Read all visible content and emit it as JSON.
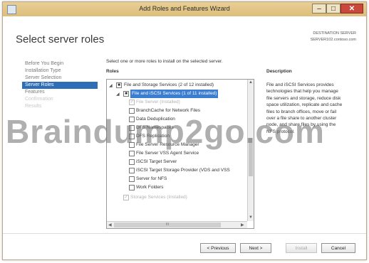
{
  "window": {
    "title": "Add Roles and Features Wizard",
    "controls": {
      "minimize": "‒",
      "maximize": "□",
      "close": "✕"
    }
  },
  "header": {
    "page_title": "Select server roles",
    "destination_label": "DESTINATION SERVER",
    "destination_server": "SERVER102.contoso.com"
  },
  "nav": {
    "items": [
      {
        "label": "Before You Begin"
      },
      {
        "label": "Installation Type"
      },
      {
        "label": "Server Selection"
      },
      {
        "label": "Server Roles"
      },
      {
        "label": "Features"
      },
      {
        "label": "Confirmation"
      },
      {
        "label": "Results"
      }
    ]
  },
  "main": {
    "instruction": "Select one or more roles to install on the selected server.",
    "roles_header": "Roles",
    "roles": [
      "File and Storage Services (2 of 12 installed)",
      "File and iSCSI Services (1 of 11 installed)",
      "File Server (Installed)",
      "BranchCache for Network Files",
      "Data Deduplication",
      "DFS Namespaces",
      "DFS Replication",
      "File Server Resource Manager",
      "File Server VSS Agent Service",
      "iSCSI Target Server",
      "iSCSI Target Storage Provider (VDS and VSS",
      "Server for NFS",
      "Work Folders",
      "Storage Services (Installed)"
    ],
    "description_header": "Description",
    "description_lines": [
      "File and iSCSI Services provides",
      "technologies that help you manage",
      "file servers and storage, reduce disk",
      "space utilization, replicate and cache",
      "files to branch offices, move or fail",
      "over a file share to another cluster",
      "node, and share files by using the",
      "NFS protocol."
    ],
    "scroll_grip": "III"
  },
  "watermark": "Braindump2go.com",
  "buttons": {
    "previous": "< Previous",
    "next": "Next >",
    "install": "Install",
    "cancel": "Cancel"
  }
}
